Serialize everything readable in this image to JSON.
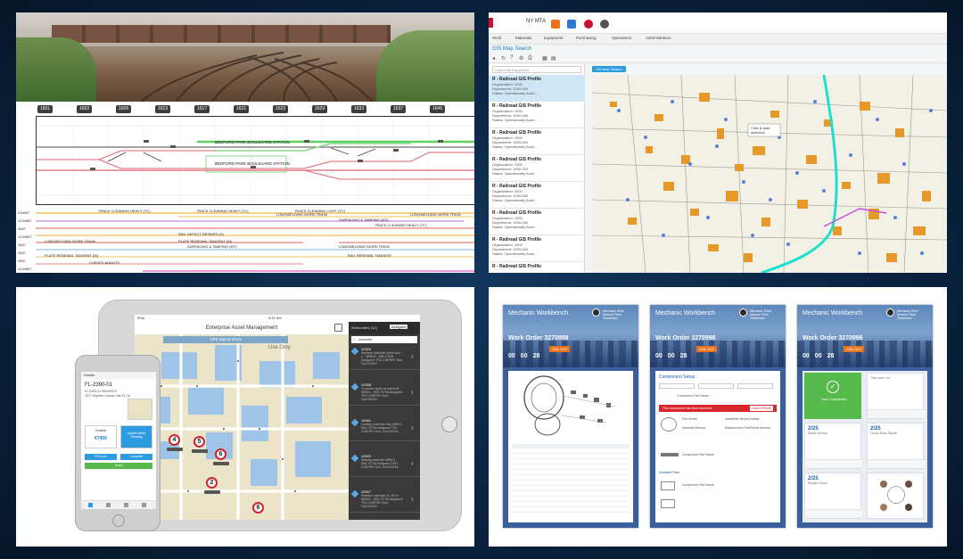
{
  "panel_rail": {
    "years": [
      "1601",
      "1603",
      "1609",
      "1613",
      "1617",
      "1621",
      "1623",
      "1629",
      "1633",
      "1637",
      "1645"
    ],
    "stations": [
      "BEDFORD PARK BOULEVARD STATION",
      "BEDFORD PARK BOULEVARD STATION"
    ],
    "row_labels": [
      "234567",
      "1234567",
      "4567",
      "1234567",
      "1567",
      "4567",
      "4567",
      "1234567"
    ],
    "tasks": [
      "TRACK CLEANING HEAVY (TC)",
      "TRACK CLEANING HEAVY (TC)",
      "TRACK CLEANING LIGHT (TC)",
      "LONGWELDING WORK TRAIN",
      "LONGWELDING WORK TRAIN",
      "SURFACING & TAMPING (MT)",
      "TRACK CLEANING HEAVY (TC)",
      "RAIL DEFECT REPAIRS (D)",
      "LONGWELDING WORK TRAIN",
      "PLATE RENEWAL TANGENT (M)",
      "SURFACING & TAMPING (MT)",
      "LONGWELDING WORK TRAIN",
      "PLATE RENEWAL TANGENT (M)",
      "RAIL RENEWAL TANGENT",
      "CURVES ADAGTS"
    ]
  },
  "panel_gis": {
    "brand": "NY MTA",
    "menu": [
      "Work",
      "Materials",
      "Equipment",
      "Purchasing",
      "Operations",
      "Administration"
    ],
    "subtitle": "GIS Map Search",
    "search_placeholder": "Search All Equipment",
    "map_button": "GIS Map Search",
    "items": [
      {
        "title": "R - Railroad GIS Profile",
        "org": "Organization: 1000",
        "dept": "Department: 1000-000",
        "status": "Status: Operationally Avail..."
      },
      {
        "title": "R - Railroad GIS Profile",
        "org": "Organization: 1000",
        "dept": "Department: 1000-000",
        "status": "Status: Operationally Avail..."
      },
      {
        "title": "R - Railroad GIS Profile",
        "org": "Organization: 1000",
        "dept": "Department: 1000-000",
        "status": "Status: Operationally Avail..."
      },
      {
        "title": "R - Railroad GIS Profile",
        "org": "Organization: 1000",
        "dept": "Department: 1000-000",
        "status": "Status: Operationally Avail..."
      },
      {
        "title": "R - Railroad GIS Profile",
        "org": "Organization: 1000",
        "dept": "Department: 1000-000",
        "status": "Status: Operationally Avail..."
      },
      {
        "title": "R - Railroad GIS Profile",
        "org": "Organization: 1000",
        "dept": "Department: 1000-000",
        "status": "Status: Operationally Avail..."
      },
      {
        "title": "R - Railroad GIS Profile",
        "org": "Organization: 1000",
        "dept": "Department: 1000-000",
        "status": "Status: Operationally Avail..."
      },
      {
        "title": "R - Railroad GIS Profile",
        "org": "",
        "dept": "",
        "status": ""
      }
    ],
    "map_callout": "Click & start selection"
  },
  "panel_mobile": {
    "status_left": "iPad",
    "status_time": "9:41 AM",
    "title": "Enterprise Asset Management",
    "map_banner": "UPS Signal Line1",
    "map_region": "Use Only",
    "side_header": "Workorders (12)",
    "side_assigned": "Assigned",
    "search_value": "manhole",
    "workorders": [
      {
        "num": "10324",
        "desc": "Replace manhole frame and c... WRKO - 899-70706 Assigned: TED CHERRY Due: 04/14/2016"
      },
      {
        "num": "10308",
        "desc": "Concrete repair at manhole... WRKO - 899-70706 Assigned: TED CHERRY Due: 04/14/2016"
      },
      {
        "num": "10401",
        "desc": "Leaking manhole ring WRKO - 899-70706 Assigned: TED CHERRY Due: 04/14/2016"
      },
      {
        "num": "10303",
        "desc": "Missing manhole WRKO - 899-70706 Assigned: TED CHERRY Due: 04/14/2016"
      },
      {
        "num": "10307",
        "desc": "Replace manhole on 7th st WRKO - 899-70706 Assigned: TED CHERRY Due: 04/14/2016"
      }
    ],
    "markers": [
      "4",
      "5",
      "6",
      "2",
      "6"
    ],
    "phone": {
      "top": "Details",
      "id": "FL-2390-01",
      "line1": "FL-2390-01 MANHOLE",
      "line2": "2377 Highline Sunset Oak 91 CA",
      "card1_label": "Created",
      "card1_value": "€7450",
      "card2_label": "Update Meter Reading",
      "btn_left": "Fill to-do",
      "btn_right": "Complete",
      "btn_bottom": "Tasks"
    }
  },
  "panel_mechanic": {
    "title": "Mechanic Workbench",
    "user": "Mechanic Elliot Moreno Fleet Technician",
    "work_order": "Work Order 3270998",
    "timer": [
      "00",
      "00",
      "28"
    ],
    "job_out": "JOB OUT",
    "screen2_section": "Component Setup",
    "screen2_alert": "This component has been removed",
    "screen2_alert_action": "Undo & Reset",
    "screen2_fields": [
      "Component Part Name",
      "Part Model",
      "Install/Set Serial Number",
      "Manhole Manual",
      "Replacement Part/Serial Number",
      "Available Parts",
      "Component Part Name",
      "Component Part Name"
    ],
    "screen3_status": "Task Completed",
    "screen3_labels": [
      "Tires worn out",
      "Safety Mirrors",
      "Check Body Repair",
      "Fix Seat Repair",
      "Repaint Wiper"
    ],
    "screen3_counts": [
      "2/25",
      "2/25",
      "2/25"
    ],
    "colors": {
      "accent_orange": "#e8731b",
      "success_green": "#55b94c",
      "alert_red": "#d9262d"
    }
  }
}
